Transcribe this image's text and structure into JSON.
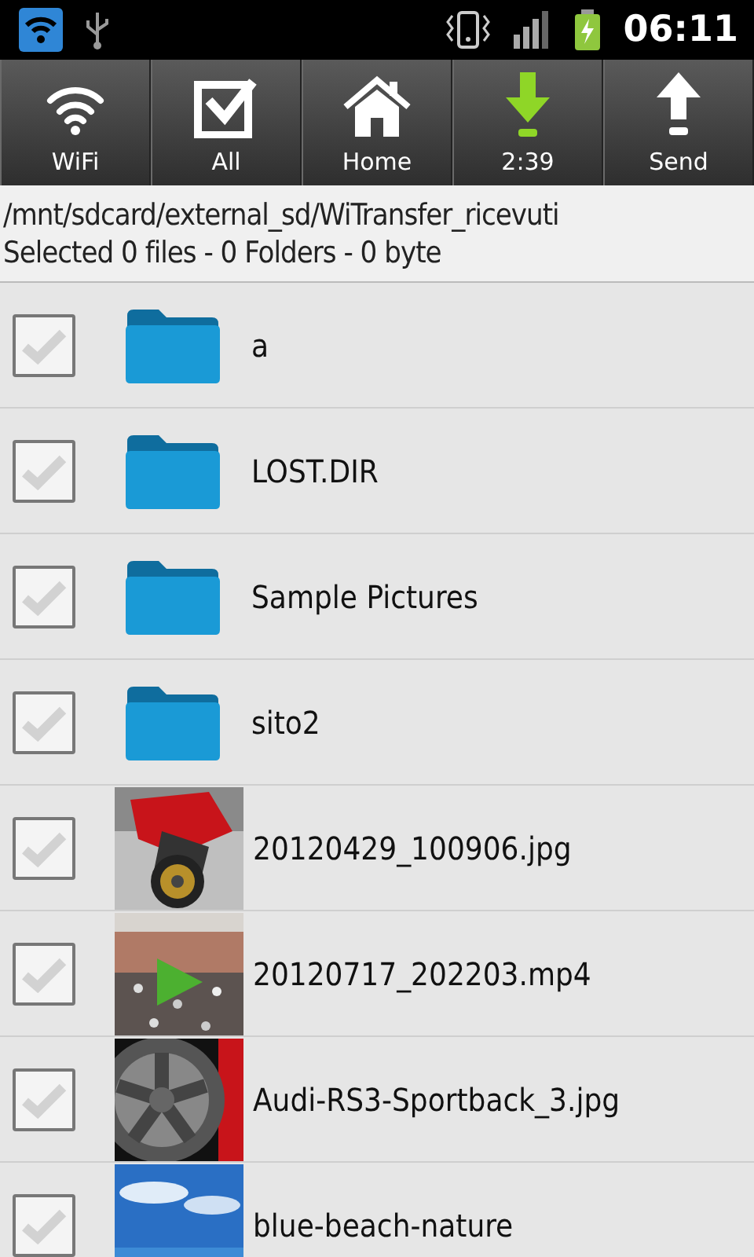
{
  "status_bar": {
    "time": "06:11"
  },
  "toolbar": [
    {
      "label": "WiFi",
      "kind": "wifi"
    },
    {
      "label": "All",
      "kind": "all"
    },
    {
      "label": "Home",
      "kind": "home"
    },
    {
      "label": "2:39",
      "kind": "download"
    },
    {
      "label": "Send",
      "kind": "send"
    }
  ],
  "path": "/mnt/sdcard/external_sd/WiTransfer_ricevuti",
  "selection_summary": "Selected 0 files - 0 Folders - 0 byte",
  "files": [
    {
      "name": "a",
      "kind": "folder",
      "checked": false
    },
    {
      "name": "LOST.DIR",
      "kind": "folder",
      "checked": false
    },
    {
      "name": "Sample Pictures",
      "kind": "folder",
      "checked": false
    },
    {
      "name": "sito2",
      "kind": "folder",
      "checked": false
    },
    {
      "name": "20120429_100906.jpg",
      "checked": false
    },
    {
      "name": "20120717_202203.mp4",
      "kind": "video",
      "checked": false
    },
    {
      "name": "Audi-RS3-Sportback_3.jpg",
      "checked": false
    },
    {
      "name": "blue-beach-nature",
      "checked": false
    }
  ]
}
